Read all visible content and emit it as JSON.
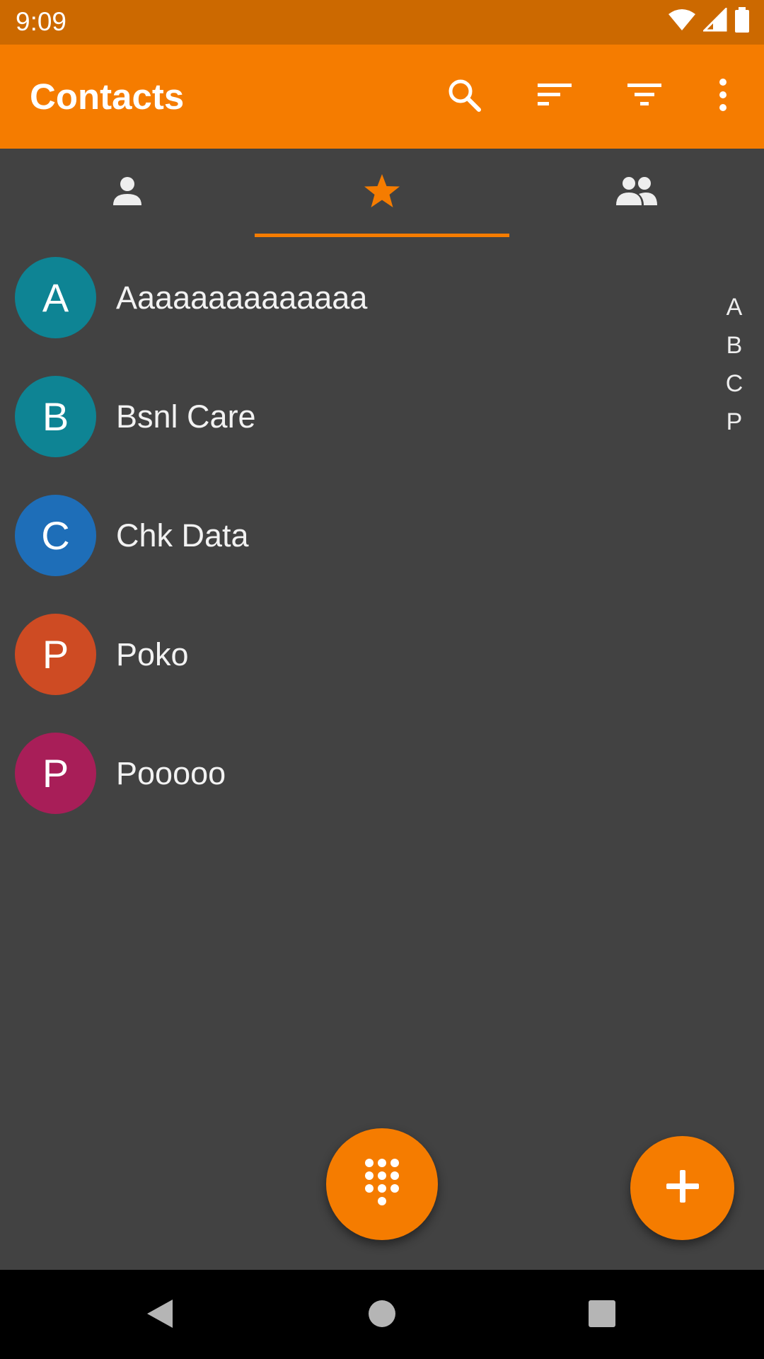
{
  "status_bar": {
    "time": "9:09",
    "icons": [
      "wifi-icon",
      "signal-icon",
      "battery-icon"
    ]
  },
  "app_bar": {
    "title": "Contacts",
    "actions": [
      "search-icon",
      "sort-icon",
      "filter-icon",
      "more-vert-icon"
    ]
  },
  "tabs": [
    {
      "icon": "person-icon",
      "selected": false
    },
    {
      "icon": "star-icon",
      "selected": true
    },
    {
      "icon": "group-icon",
      "selected": false
    }
  ],
  "contacts": [
    {
      "initial": "A",
      "name": "Aaaaaaaaaaaaaa",
      "color": "#0E8494"
    },
    {
      "initial": "B",
      "name": "Bsnl Care",
      "color": "#0E8494"
    },
    {
      "initial": "C",
      "name": "Chk Data",
      "color": "#1E6EB8"
    },
    {
      "initial": "P",
      "name": "Poko",
      "color": "#CE4B23"
    },
    {
      "initial": "P",
      "name": "Pooooo",
      "color": "#A81E58"
    }
  ],
  "fast_scroller": [
    "A",
    "B",
    "C",
    "P"
  ],
  "fabs": {
    "dialpad": "dialpad-icon",
    "add": "add-icon"
  },
  "colors": {
    "accent": "#F57C00",
    "status_bar": "#CC6900",
    "background": "#424242"
  },
  "nav_bar": [
    "back-icon",
    "home-icon",
    "recents-icon"
  ]
}
